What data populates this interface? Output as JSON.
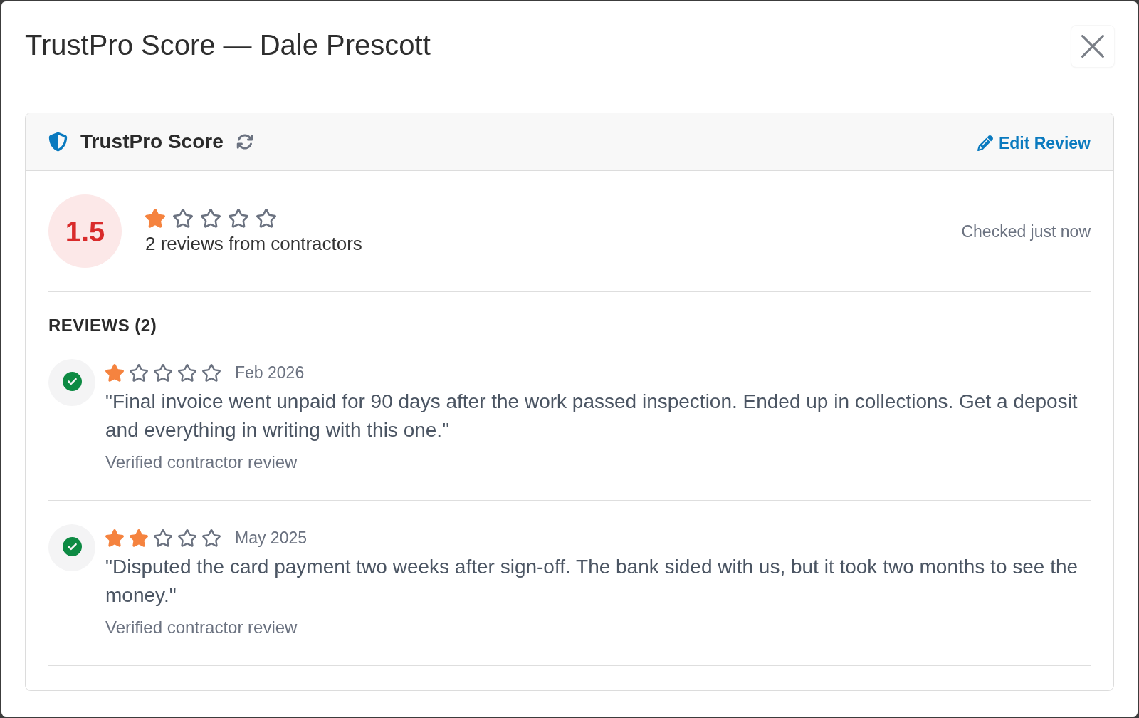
{
  "dialog": {
    "title": "TrustPro Score — Dale Prescott"
  },
  "score_card": {
    "title": "TrustPro Score",
    "edit_action": "Edit Review",
    "score": "1.5",
    "stars": 1,
    "summary": "2 reviews from contractors",
    "checked": "Checked just now",
    "reviews_heading": "REVIEWS (2)",
    "reviews": [
      {
        "verified": true,
        "stars": 1,
        "date": "Feb 2026",
        "text": "\"Final invoice went unpaid for 90 days after the work passed inspection. Ended up in collections. Get a deposit and everything in writing with this one.\"",
        "note": "Verified contractor review"
      },
      {
        "verified": true,
        "stars": 2,
        "date": "May 2025",
        "text": "\"Disputed the card payment two weeks after sign-off. The bank sided with us, but it took two months to see the money.\"",
        "note": "Verified contractor review"
      }
    ]
  }
}
